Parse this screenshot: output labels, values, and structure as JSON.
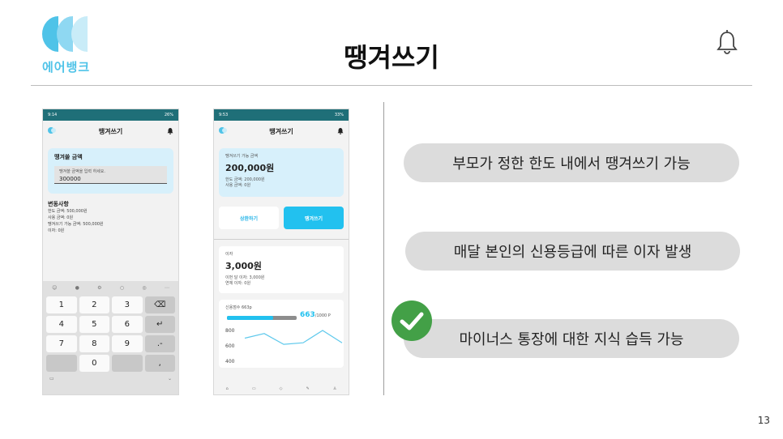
{
  "slide": {
    "title": "땡겨쓰기",
    "logo_text": "에어뱅크",
    "page_number": "13"
  },
  "phone1": {
    "status_left": "9:14",
    "status_right": "26%",
    "title": "땡겨쓰기",
    "card_title": "땡겨쓸 금액",
    "input_placeholder": "땡겨쓸 금액을 입력 하세요.",
    "input_value": "300000",
    "changes_title": "변동사항",
    "changes": [
      "한도 금액: 500,000원",
      "사용 금액: 0원",
      "땡겨쓰기 가능 금액: 500,000원",
      "이자: 0원"
    ],
    "keys": [
      "1",
      "2",
      "3",
      "⌫",
      "4",
      "5",
      "6",
      "↵",
      "7",
      "8",
      "9",
      ".-",
      "",
      "0",
      "",
      ","
    ]
  },
  "phone2": {
    "status_left": "9:53",
    "status_right": "33%",
    "title": "땡겨쓰기",
    "avail_label": "땡겨쓰기 가능 금액",
    "avail_amount": "200,000원",
    "limit_line": "한도 금액: 200,000원",
    "used_line": "사용 금액: 0원",
    "repay_button": "상환하기",
    "borrow_button": "땡겨쓰기",
    "interest_label": "이자",
    "interest_amount": "3,000원",
    "interest_line1": "이번 달 이자: 3,000원",
    "interest_line2": "연체 이자: 0원",
    "credit_label": "신용점수 663p",
    "credit_score": "663",
    "credit_max": "/1000 P",
    "credit_fraction": 0.663,
    "chart_ticks": [
      "800",
      "600",
      "400"
    ],
    "chart_values": [
      700,
      760,
      620,
      640,
      800,
      640
    ]
  },
  "features": [
    "부모가 정한 한도 내에서 땡겨쓰기 가능",
    "매달 본인의 신용등급에 따른 이자 발생",
    "마이너스 통장에 대한 지식 습득 가능"
  ],
  "colors": {
    "accent": "#22c1ef",
    "card_blue": "#d7f0fb",
    "check_green": "#43a047",
    "pill_gray": "#dcdcdc"
  }
}
